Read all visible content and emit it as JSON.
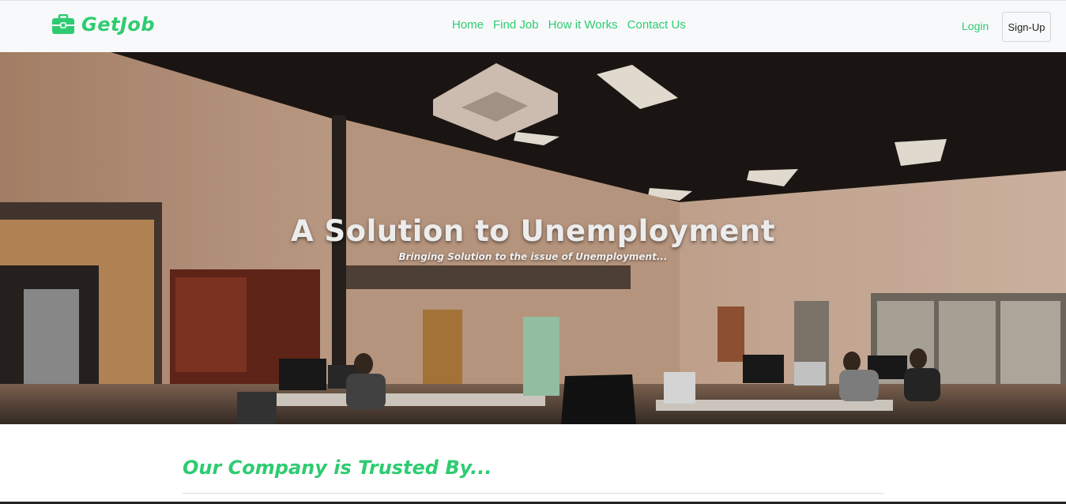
{
  "brand": {
    "name": "GetJob",
    "icon": "briefcase-icon",
    "color": "#2ecc71"
  },
  "nav": {
    "links": [
      {
        "label": "Home"
      },
      {
        "label": "Find Job"
      },
      {
        "label": "How it Works"
      },
      {
        "label": "Contact Us"
      }
    ],
    "login_label": "Login",
    "signup_label": "Sign-Up"
  },
  "hero": {
    "title": "A Solution to Unemployment",
    "subtitle": "Bringing Solution to the issue of Unemployment..."
  },
  "section": {
    "heading": "Our Company is Trusted By..."
  },
  "colors": {
    "accent": "#2ecc71",
    "navbar_bg": "#f8f9fa"
  }
}
